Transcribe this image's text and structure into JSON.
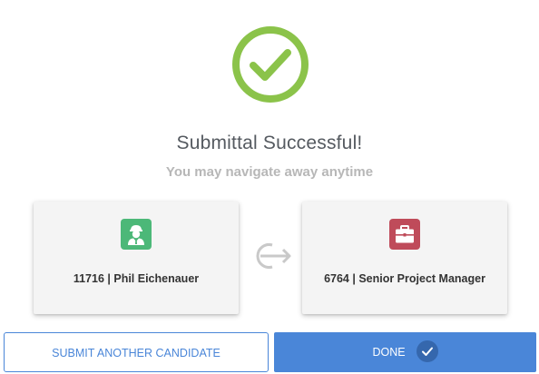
{
  "header": {
    "title": "Submittal Successful!",
    "subtitle": "You may navigate away anytime"
  },
  "icons": {
    "success": "check-circle-icon",
    "candidate": "person-icon",
    "job": "briefcase-icon",
    "transfer": "arrow-right-circle-icon",
    "done": "check-icon"
  },
  "candidate_card": {
    "label": "11716 | Phil Eichenauer"
  },
  "job_card": {
    "label": "6764 | Senior Project Manager"
  },
  "actions": {
    "submit_another_label": "SUBMIT ANOTHER CANDIDATE",
    "done_label": "DONE"
  },
  "colors": {
    "success_green": "#8bc34a",
    "candidate_green": "#4cb878",
    "job_red": "#bf4b5a",
    "accent_blue": "#4a86d8"
  }
}
